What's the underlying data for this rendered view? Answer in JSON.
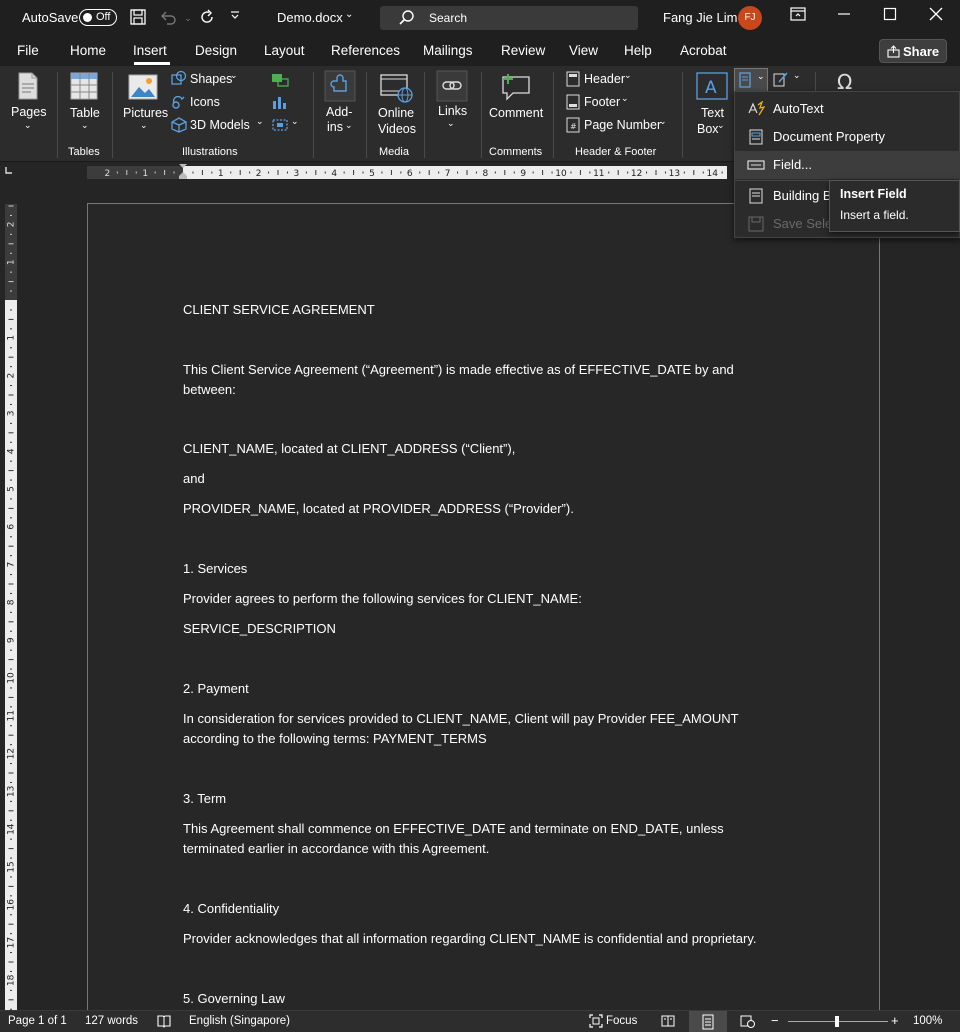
{
  "titlebar": {
    "autosave_label": "AutoSave",
    "autosave_state": "Off",
    "doc_title": "Demo.docx",
    "search_placeholder": "Search",
    "user_name": "Fang Jie Lim",
    "user_initials": "FJ"
  },
  "tabs": [
    "File",
    "Home",
    "Insert",
    "Design",
    "Layout",
    "References",
    "Mailings",
    "Review",
    "View",
    "Help",
    "Acrobat"
  ],
  "share_label": "Share",
  "ribbon": {
    "pages": "Pages",
    "table": "Table",
    "pictures": "Pictures",
    "shapes": "Shapes",
    "icons": "Icons",
    "models3d": "3D Models",
    "addins_1": "Add-",
    "addins_2": "ins",
    "online_1": "Online",
    "online_2": "Videos",
    "links": "Links",
    "comment": "Comment",
    "header": "Header",
    "footer": "Footer",
    "page_number": "Page Number",
    "textbox_1": "Text",
    "textbox_2": "Box",
    "groups": {
      "tables": "Tables",
      "illustrations": "Illustrations",
      "media": "Media",
      "comments": "Comments",
      "header_footer": "Header & Footer"
    }
  },
  "ruler": {
    "h_ticks": [
      "2",
      "1",
      "1",
      "2",
      "3",
      "4",
      "5",
      "6",
      "7",
      "8",
      "9",
      "10",
      "11",
      "12",
      "13",
      "14"
    ],
    "v_ticks": [
      "2",
      "1",
      "1",
      "2",
      "3",
      "4",
      "5",
      "6",
      "7",
      "8",
      "9",
      "10",
      "11",
      "12",
      "13",
      "14",
      "15",
      "16",
      "17",
      "18"
    ]
  },
  "document": {
    "title": "CLIENT SERVICE AGREEMENT",
    "intro_1": "This Client Service Agreement (“Agreement”) is made effective as of EFFECTIVE_DATE by and",
    "intro_2": "between:",
    "client": "CLIENT_NAME, located at CLIENT_ADDRESS (“Client”),",
    "and": "and",
    "provider": "PROVIDER_NAME, located at PROVIDER_ADDRESS (“Provider”).",
    "s1_head": "1. Services",
    "s1_body": "Provider agrees to perform the following services for CLIENT_NAME:",
    "s1_desc": "SERVICE_DESCRIPTION",
    "s2_head": "2. Payment",
    "s2_body_1": "In consideration for services provided to CLIENT_NAME, Client will pay Provider FEE_AMOUNT",
    "s2_body_2": "according to the following terms: PAYMENT_TERMS",
    "s3_head": "3. Term",
    "s3_body_1": "This Agreement shall commence on EFFECTIVE_DATE and terminate on END_DATE, unless",
    "s3_body_2": "terminated earlier in accordance with this Agreement.",
    "s4_head": "4. Confidentiality",
    "s4_body": "Provider acknowledges that all information regarding CLIENT_NAME is confidential and proprietary.",
    "s5_head": "5. Governing Law"
  },
  "dropdown": {
    "autotext": "AutoText",
    "doc_property": "Document Property",
    "field": "Field...",
    "building_blocks": "Building Bl",
    "save_selection": "Save Select"
  },
  "tooltip": {
    "title": "Insert Field",
    "desc": "Insert a field."
  },
  "statusbar": {
    "page": "Page 1 of 1",
    "words": "127 words",
    "language": "English (Singapore)",
    "focus": "Focus",
    "zoom": "100%"
  },
  "colors": {
    "accent_avatar": "#c8471b",
    "background": "#252525",
    "ribbon": "#2c2c2c"
  }
}
